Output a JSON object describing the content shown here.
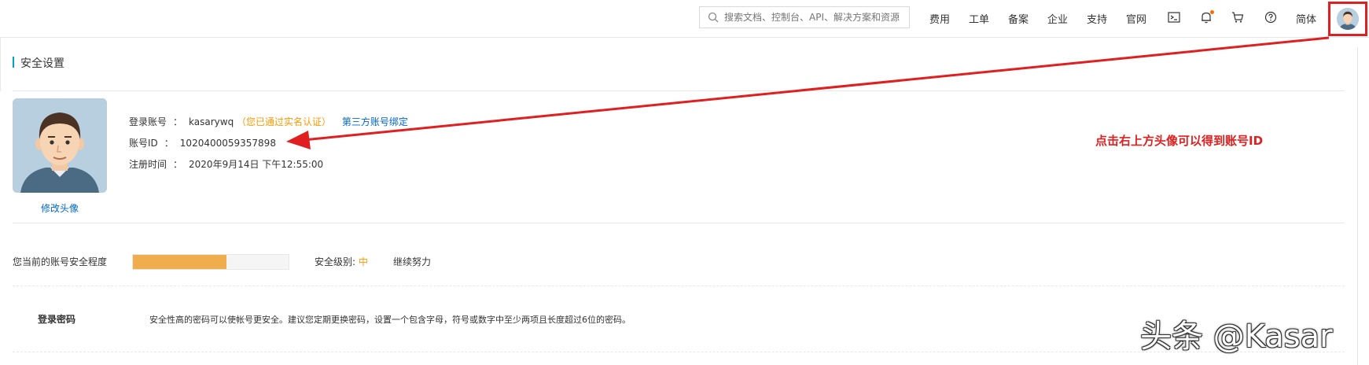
{
  "topbar": {
    "search_placeholder": "搜索文档、控制台、API、解决方案和资源",
    "nav": [
      "费用",
      "工单",
      "备案",
      "企业",
      "支持",
      "官网"
    ],
    "lang": "简体"
  },
  "page": {
    "title": "安全设置"
  },
  "profile": {
    "change_avatar": "修改头像",
    "login_account_label": "登录账号",
    "colon": "：",
    "login_account_value": "kasarywq",
    "verified_text": "（您已通过实名认证）",
    "third_party_link": "第三方账号绑定",
    "account_id_label": "账号ID",
    "account_id_value": "1020400059357898",
    "register_time_label": "注册时间",
    "register_time_value": "2020年9月14日 下午12:55:00"
  },
  "annotation": {
    "text": "点击右上方头像可以得到账号ID",
    "color": "#e02020"
  },
  "security": {
    "degree_label": "您当前的账号安全程度",
    "progress": 0.6,
    "level_label": "安全级别:",
    "level_value": "中",
    "keep_text": "继续努力"
  },
  "password": {
    "label": "登录密码",
    "description": "安全性高的密码可以使帐号更安全。建议您定期更换密码，设置一个包含字母，符号或数字中至少两项且长度超过6位的密码。"
  },
  "watermark": "头条 @Kasar",
  "colors": {
    "accent": "#00a2ca",
    "link": "#0066cc",
    "warning": "#ff9900",
    "progress_fill": "#f0ad4e",
    "highlight": "#e02020"
  }
}
